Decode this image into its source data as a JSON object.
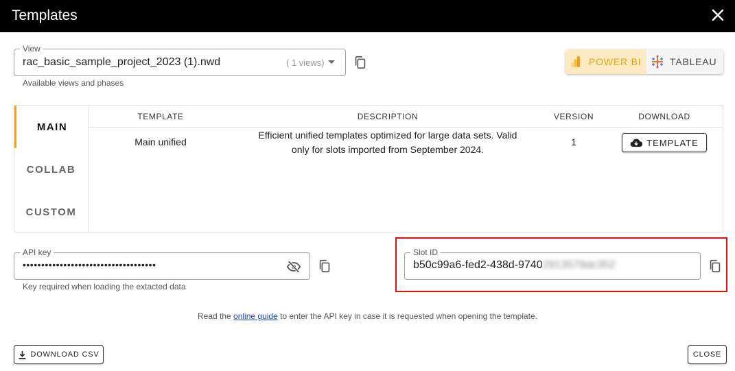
{
  "header": {
    "title": "Templates",
    "close_icon": "close-icon"
  },
  "view_field": {
    "legend": "View",
    "value": "rac_basic_sample_project_2023 (1).nwd",
    "views_count": "( 1 views)",
    "helper": "Available views and phases"
  },
  "bi_toggle": {
    "powerbi_label": "POWER BI",
    "tableau_label": "TABLEAU",
    "selected": "POWER BI",
    "accent_color": "#e8a21a"
  },
  "tabs": [
    {
      "label": "MAIN",
      "active": true
    },
    {
      "label": "COLLAB",
      "active": false
    },
    {
      "label": "CUSTOM",
      "active": false
    }
  ],
  "table": {
    "headers": [
      "TEMPLATE",
      "DESCRIPTION",
      "VERSION",
      "DOWNLOAD"
    ],
    "rows": [
      {
        "template": "Main unified",
        "description_line1": "Efficient unified templates optimized for large data sets. Valid",
        "description_line2": "only for slots imported from September 2024.",
        "version": "1",
        "download_label": "TEMPLATE"
      }
    ]
  },
  "api_key": {
    "legend": "API key",
    "value": "••••••••••••••••••••••••••••••••••••",
    "helper": "Key required when loading the extacted data"
  },
  "slot_id": {
    "legend": "Slot ID",
    "value": "b50c99a6-fed2-438d-9740",
    "value_blurred": "2913579dc352"
  },
  "guide": {
    "prefix": "Read the ",
    "link": "online guide",
    "suffix": " to enter the API key in case it is requested when opening the template."
  },
  "footer": {
    "download_csv_label": "DOWNLOAD CSV",
    "close_label": "CLOSE"
  }
}
